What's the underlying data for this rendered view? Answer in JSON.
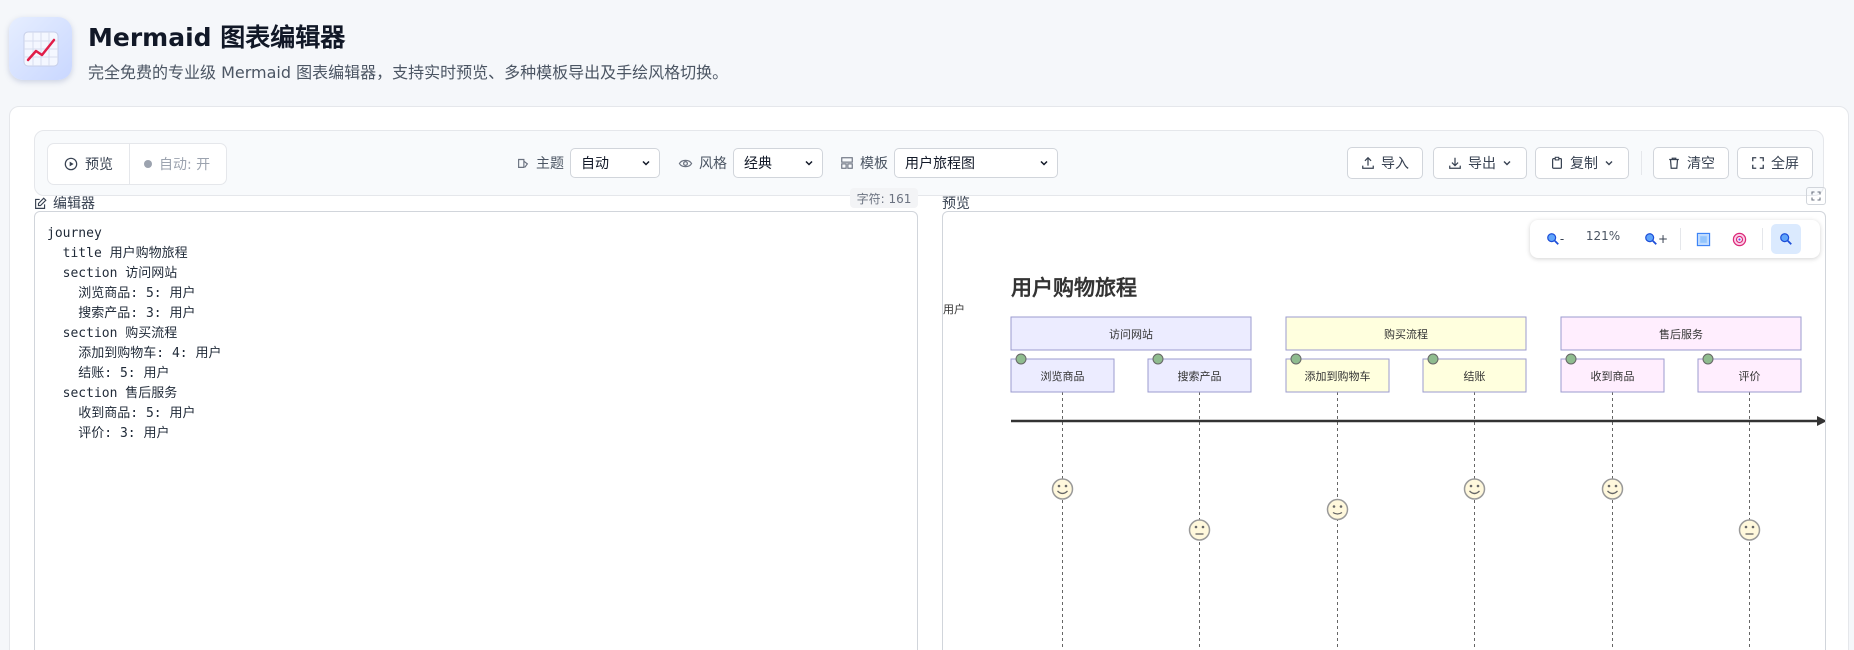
{
  "header": {
    "title": "Mermaid 图表编辑器",
    "subtitle": "完全免费的专业级 Mermaid 图表编辑器，支持实时预览、多种模板导出及手绘风格切换。"
  },
  "toolbar": {
    "preview_label": "预览",
    "auto_label": "自动: 开",
    "theme_label": "主题",
    "theme_value": "自动",
    "style_label": "风格",
    "style_value": "经典",
    "template_label": "模板",
    "template_value": "用户旅程图",
    "import_label": "导入",
    "export_label": "导出",
    "copy_label": "复制",
    "clear_label": "清空",
    "fullscreen_label": "全屏"
  },
  "editor": {
    "label": "编辑器",
    "char_count": "字符: 161",
    "code": "journey\n  title 用户购物旅程\n  section 访问网站\n    浏览商品: 5: 用户\n    搜索产品: 3: 用户\n  section 购买流程\n    添加到购物车: 4: 用户\n    结账: 5: 用户\n  section 售后服务\n    收到商品: 5: 用户\n    评价: 3: 用户"
  },
  "preview": {
    "label": "预览",
    "zoom_out": "-",
    "zoom_in": "+",
    "zoom_level": "121%"
  },
  "diagram": {
    "title": "用户购物旅程",
    "actor": "用户",
    "sections": [
      {
        "name": "访问网站",
        "color": "#ececff",
        "tasks": [
          {
            "name": "浏览商品",
            "score": 5
          },
          {
            "name": "搜索产品",
            "score": 3
          }
        ]
      },
      {
        "name": "购买流程",
        "color": "#ffffde",
        "tasks": [
          {
            "name": "添加到购物车",
            "score": 4
          },
          {
            "name": "结账",
            "score": 5
          }
        ]
      },
      {
        "name": "售后服务",
        "color": "#ffeefe",
        "tasks": [
          {
            "name": "收到商品",
            "score": 5
          },
          {
            "name": "评价",
            "score": 3
          }
        ]
      }
    ]
  },
  "colors": {
    "accent": "#2563eb",
    "task_border": "#9b9bcf",
    "face_fill": "#fff8dc"
  }
}
